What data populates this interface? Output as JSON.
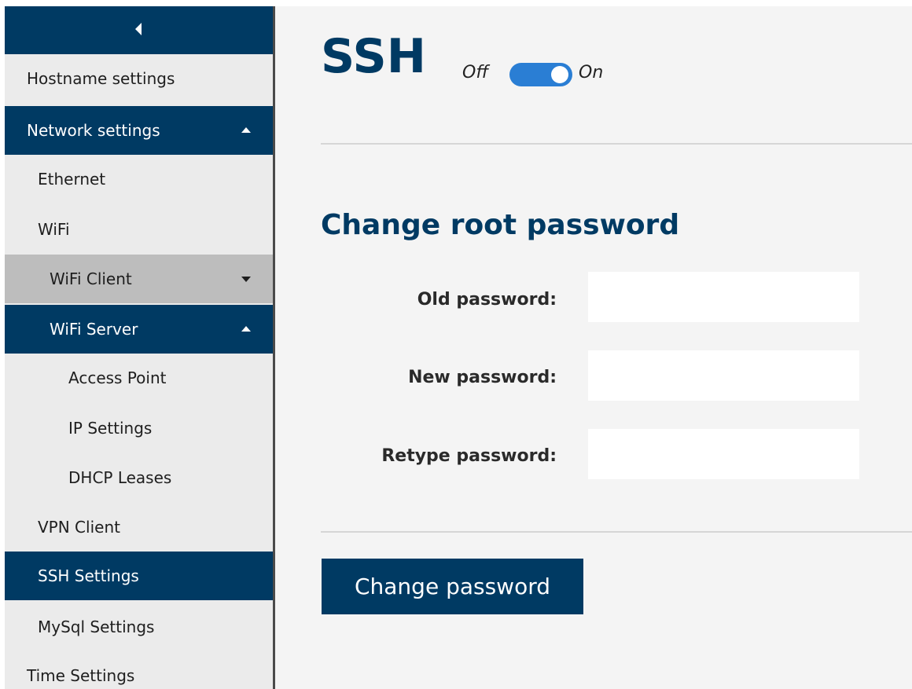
{
  "sidebar": {
    "items": [
      {
        "label": "Hostname settings"
      },
      {
        "label": "Network settings"
      },
      {
        "label": "Ethernet"
      },
      {
        "label": "WiFi"
      },
      {
        "label": "WiFi Client"
      },
      {
        "label": "WiFi Server"
      },
      {
        "label": "Access Point"
      },
      {
        "label": "IP Settings"
      },
      {
        "label": "DHCP Leases"
      },
      {
        "label": "VPN Client"
      },
      {
        "label": "SSH Settings"
      },
      {
        "label": "MySql Settings"
      },
      {
        "label": "Time Settings"
      }
    ],
    "active_item": "SSH Settings"
  },
  "main": {
    "title": "SSH",
    "toggle": {
      "off_label": "Off",
      "on_label": "On",
      "state": "on"
    },
    "section_title": "Change root password",
    "fields": [
      {
        "label": "Old password:",
        "value": ""
      },
      {
        "label": "New password:",
        "value": ""
      },
      {
        "label": "Retype password:",
        "value": ""
      }
    ],
    "submit_label": "Change password"
  },
  "colors": {
    "primary": "#003a63",
    "toggle_on": "#2a7ed4",
    "sidebar_bg": "#ebebeb",
    "main_bg": "#f4f4f4",
    "sub_open_bg": "#bdbdbd"
  }
}
